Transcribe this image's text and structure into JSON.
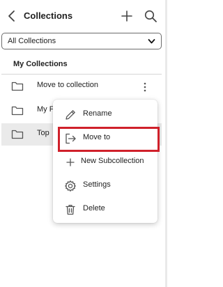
{
  "header": {
    "title": "Collections",
    "back_icon": "chevron-left-icon",
    "add_icon": "plus-icon",
    "search_icon": "search-icon"
  },
  "filter": {
    "selected": "All Collections",
    "icon": "chevron-down-icon"
  },
  "section": {
    "heading": "My Collections"
  },
  "rows": [
    {
      "label": "Move to collection",
      "icon": "folder-icon"
    },
    {
      "label": "My F",
      "icon": "folder-icon"
    },
    {
      "label": "Top",
      "icon": "folder-icon"
    }
  ],
  "context_menu": {
    "items": [
      {
        "label": "Rename",
        "icon": "pencil-icon"
      },
      {
        "label": "Move to",
        "icon": "move-to-icon"
      },
      {
        "label": "New Subcollection",
        "icon": "plus-icon"
      },
      {
        "label": "Settings",
        "icon": "gear-icon"
      },
      {
        "label": "Delete",
        "icon": "trash-icon"
      }
    ],
    "highlighted_item": "Move to"
  },
  "colors": {
    "highlight_border": "#d0202a",
    "selected_row_bg": "#eaeaea",
    "divider": "#d6d6d6"
  }
}
